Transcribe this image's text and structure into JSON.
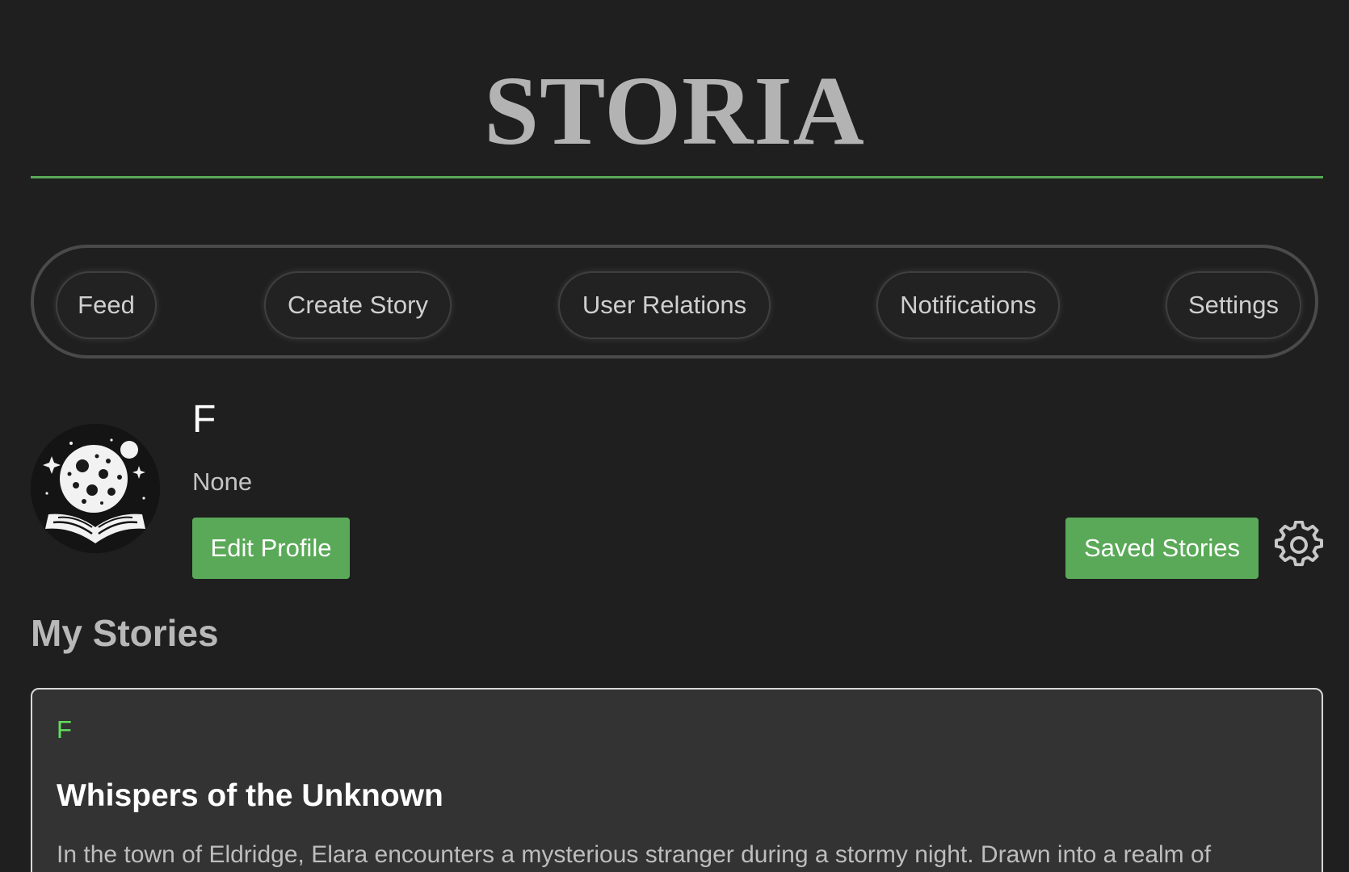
{
  "brand": {
    "title": "STORIA",
    "accent_color": "#5aa958"
  },
  "nav": {
    "items": [
      {
        "label": "Feed"
      },
      {
        "label": "Create Story"
      },
      {
        "label": "User Relations"
      },
      {
        "label": "Notifications"
      },
      {
        "label": "Settings"
      }
    ]
  },
  "profile": {
    "avatar_icon": "moon-book-avatar",
    "name": "F",
    "bio": "None",
    "edit_label": "Edit Profile",
    "saved_label": "Saved Stories",
    "settings_icon": "gear-icon"
  },
  "stories": {
    "heading": "My Stories",
    "items": [
      {
        "author": "F",
        "title": "Whispers of the Unknown",
        "excerpt": "In the town of Eldridge, Elara encounters a mysterious stranger during a stormy night. Drawn into a realm of"
      }
    ]
  }
}
